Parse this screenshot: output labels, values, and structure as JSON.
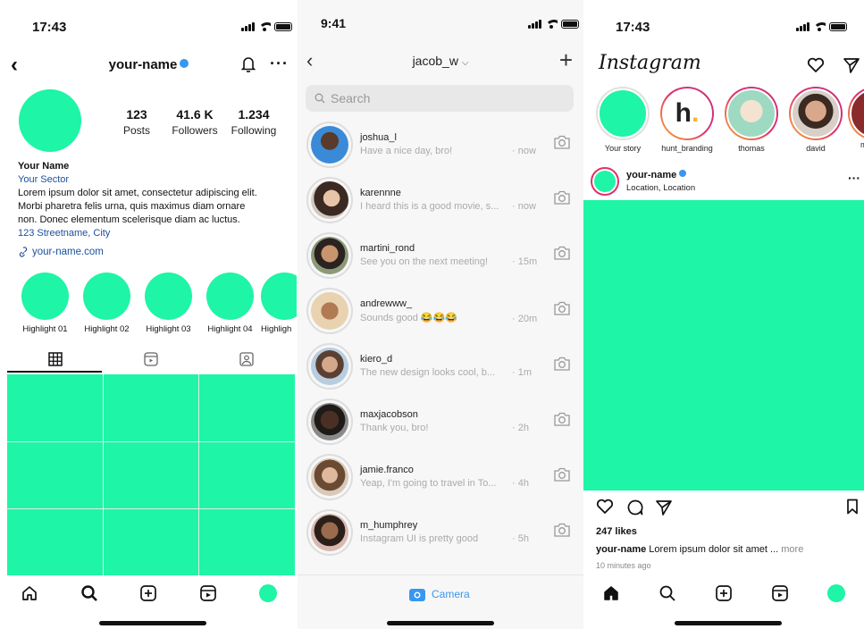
{
  "profile_screen": {
    "status_time": "17:43",
    "username": "your-name",
    "stats": [
      {
        "value": "123",
        "label": "Posts"
      },
      {
        "value": "41.6 K",
        "label": "Followers"
      },
      {
        "value": "1.234",
        "label": "Following"
      }
    ],
    "bio": {
      "name": "Your Name",
      "sector": "Your Sector",
      "text_lines": [
        "Lorem ipsum dolor sit amet, consectetur adipiscing elit.",
        "Morbi pharetra felis urna, quis maximus diam ornare",
        "non. Donec elementum scelerisque diam ac luctus."
      ],
      "address": "123 Streetname, City",
      "link": "your-name.com"
    },
    "highlights": [
      "Highlight 01",
      "Highlight 02",
      "Highlight 03",
      "Highlight 04",
      "Highligh"
    ],
    "accent_color": "#1ef5a6"
  },
  "messages_screen": {
    "status_time": "9:41",
    "title": "jacob_w",
    "search_placeholder": "Search",
    "threads": [
      {
        "name": "joshua_l",
        "message": "Have a nice day, bro!",
        "time": "· now"
      },
      {
        "name": "karennne",
        "message": "I heard this is a good movie, s...",
        "time": "· now"
      },
      {
        "name": "martini_rond",
        "message": "See you on the next meeting!",
        "time": "· 15m"
      },
      {
        "name": "andrewww_",
        "message": "Sounds good 😂😂😂",
        "time": "· 20m"
      },
      {
        "name": "kiero_d",
        "message": "The new design looks cool, b...",
        "time": "· 1m"
      },
      {
        "name": "maxjacobson",
        "message": "Thank you, bro!",
        "time": "· 2h"
      },
      {
        "name": "jamie.franco",
        "message": "Yeap, I'm going to travel in To...",
        "time": "· 4h"
      },
      {
        "name": "m_humphrey",
        "message": "Instagram UI is pretty good",
        "time": "· 5h"
      }
    ],
    "camera_label": "Camera"
  },
  "feed_screen": {
    "status_time": "17:43",
    "logo_text": "Instagram",
    "stories": [
      {
        "label": "Your story"
      },
      {
        "label": "hunt_branding"
      },
      {
        "label": "thomas"
      },
      {
        "label": "david"
      },
      {
        "label": "m"
      }
    ],
    "post": {
      "username": "your-name",
      "location": "Location, Location",
      "likes": "247 likes",
      "caption_user": "your-name",
      "caption_text": " Lorem ipsum dolor sit amet ... ",
      "caption_more": "more",
      "time_ago": "10 minutes ago"
    }
  }
}
